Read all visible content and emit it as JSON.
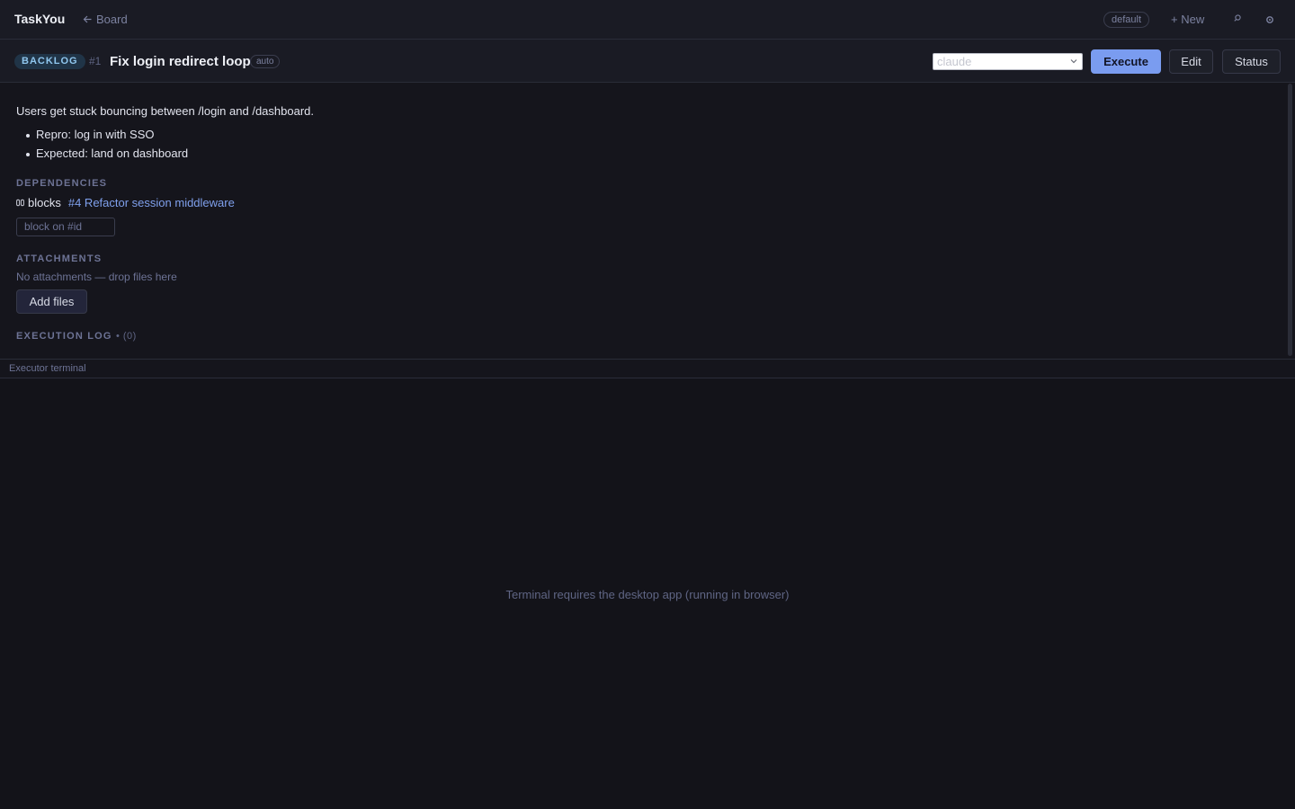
{
  "header": {
    "app_title": "TaskYou",
    "back_label": "Board",
    "workspace": "default",
    "new_label": "New",
    "icons": [
      "arrow-left-icon",
      "plus-icon",
      "search-icon",
      "gear-icon"
    ]
  },
  "task": {
    "status": "BACKLOG",
    "id": "#1",
    "title": "Fix login redirect loop",
    "mode_badge": "auto",
    "executor_value": "claude",
    "execute_label": "Execute",
    "edit_label": "Edit",
    "status_label": "Status"
  },
  "description": {
    "text": "Users get stuck bouncing between /login and /dashboard.",
    "bullets": [
      "Repro: log in with SSO",
      "Expected: land on dashboard"
    ]
  },
  "dependencies": {
    "heading": "DEPENDENCIES",
    "relation": "blocks",
    "link_text": "#4 Refactor session middleware",
    "input_placeholder": "block on #id"
  },
  "attachments": {
    "heading": "ATTACHMENTS",
    "empty_text": "No attachments — drop files here",
    "add_label": "Add files"
  },
  "execution_log": {
    "heading": "EXECUTION LOG",
    "count": "(0)"
  },
  "terminal": {
    "label": "Executor terminal",
    "message": "Terminal requires the desktop app (running in browser)"
  },
  "colors": {
    "background": "#15151c",
    "accent": "#7a9cf0",
    "status_backlog_bg": "#203447",
    "status_backlog_text": "#8fc6ee",
    "link": "#7fa0ec"
  }
}
